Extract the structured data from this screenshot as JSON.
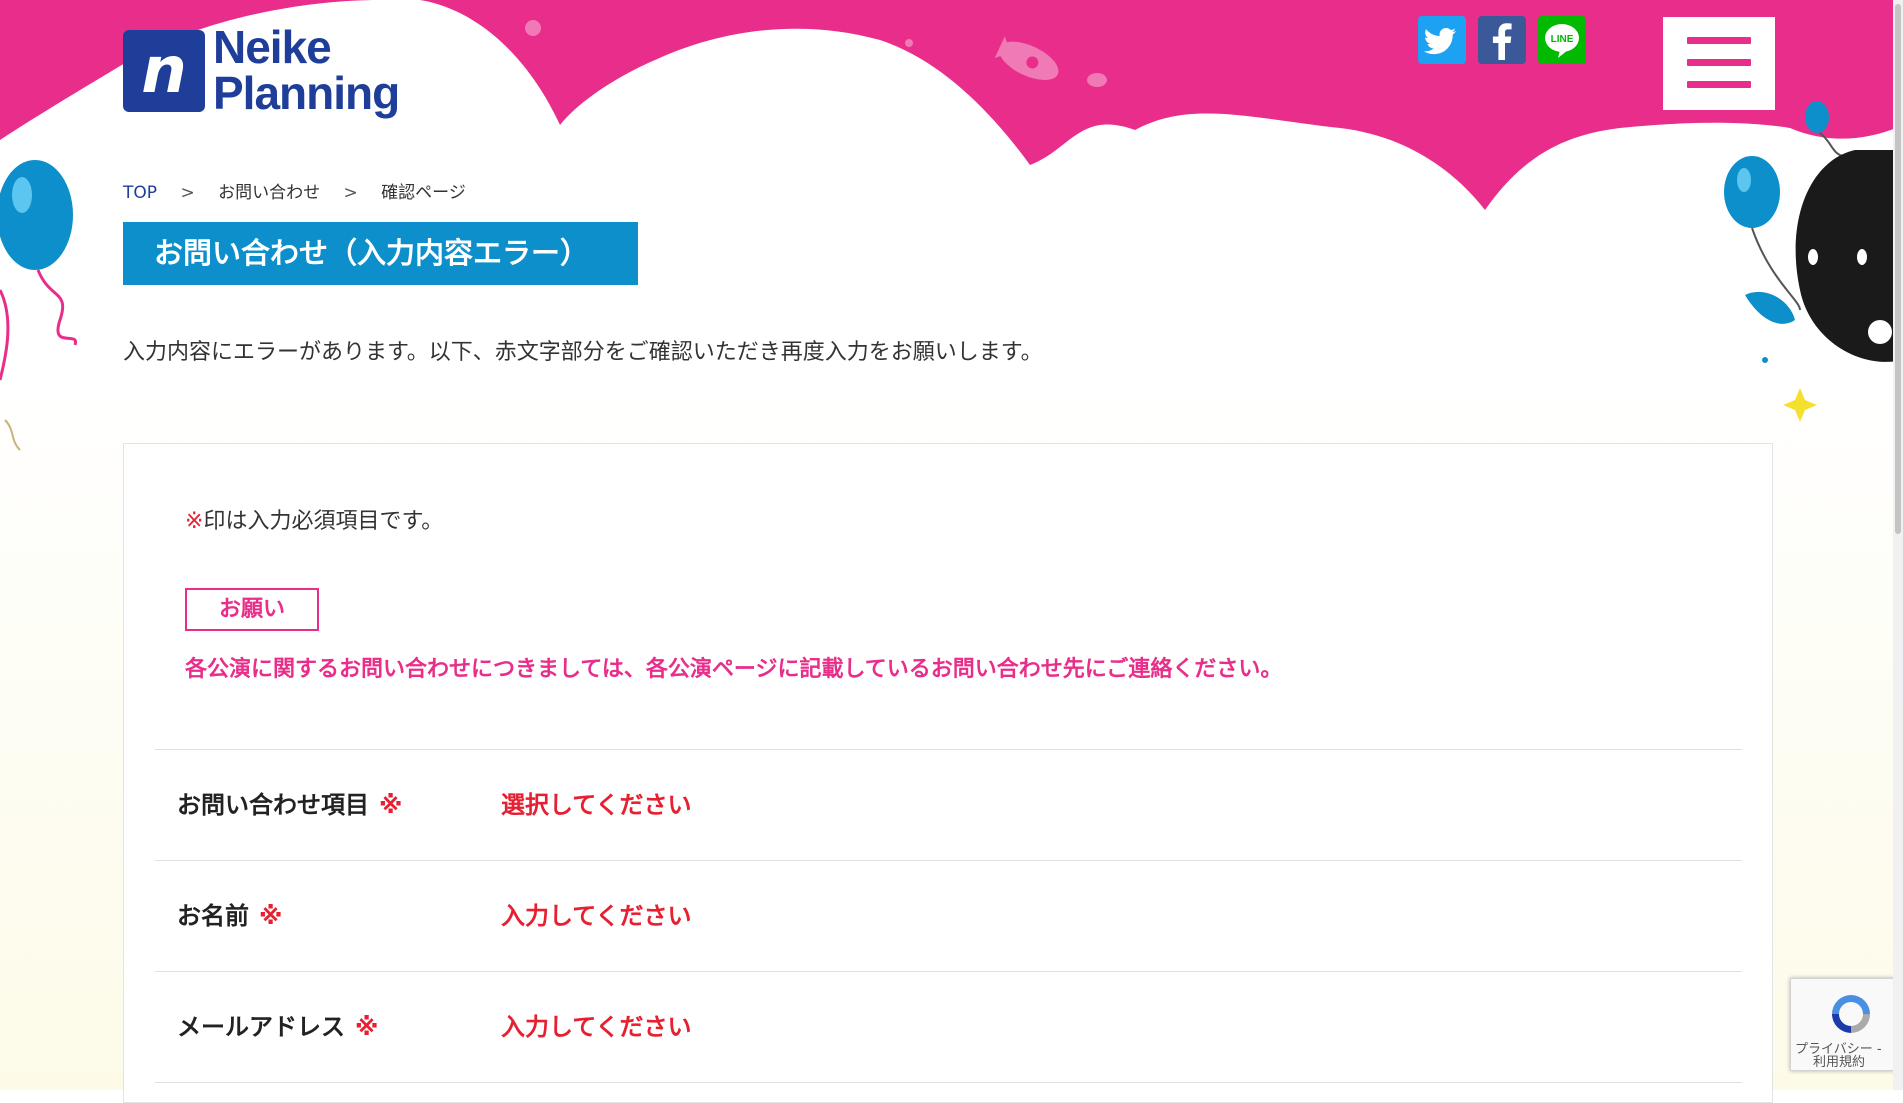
{
  "logo": {
    "mark": "n",
    "line1": "Neike",
    "line2": "Planning"
  },
  "social": [
    {
      "name": "twitter-icon",
      "color": "#1da1f2"
    },
    {
      "name": "facebook-icon",
      "color": "#3b5998"
    },
    {
      "name": "line-icon",
      "color": "#00b900",
      "text": "LINE"
    }
  ],
  "menu": {
    "icon": "hamburger-menu-icon",
    "color": "#e82e8a"
  },
  "breadcrumb": {
    "top": "TOP",
    "sep": ">",
    "contact": "お問い合わせ",
    "current": "確認ページ"
  },
  "page_title": "お問い合わせ（入力内容エラー）",
  "intro": "入力内容にエラーがあります。以下、赤文字部分をご確認いただき再度入力をお願いします。",
  "form": {
    "required_mark": "※",
    "required_note": "印は入力必須項目です。",
    "notice_label": "お願い",
    "notice_text": "各公演に関するお問い合わせにつきましては、各公演ページに記載しているお問い合わせ先にご連絡ください。",
    "rows": [
      {
        "label": "お問い合わせ項目",
        "error": "選択してください"
      },
      {
        "label": "お名前",
        "error": "入力してください"
      },
      {
        "label": "メールアドレス",
        "error": "入力してください"
      }
    ]
  },
  "recaptcha": {
    "privacy": "プライバシー",
    "sep": " - ",
    "terms": "利用規約"
  },
  "colors": {
    "pink": "#e82e8a",
    "blue": "#0c8fcb",
    "navy": "#1e3e9a",
    "error_red": "#e61f31"
  }
}
